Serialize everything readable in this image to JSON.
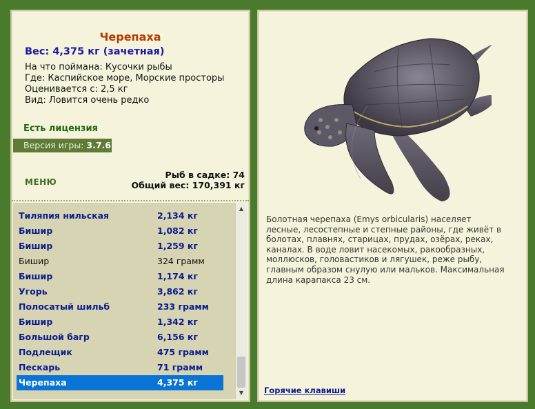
{
  "fish": {
    "title": "Черепаха",
    "weight_line": "Вес: 4,375 кг (зачетная)",
    "caught_on": "На что поймана: Кусочки рыбы",
    "location": "Где: Каспийское море, Морские просторы",
    "value": "Оценивается с: 2,5 кг",
    "rarity": "Вид: Ловится очень редко"
  },
  "license": "Есть лицензия",
  "version": {
    "label": "Версия игры:",
    "number": "3.7.6"
  },
  "menu_label": "МЕНЮ",
  "stats": {
    "fish_count": "Рыб в садке: 74",
    "total_weight": "Общий вес: 170,391 кг"
  },
  "catch_list": [
    {
      "name": "Тиляпия нильская",
      "weight": "2,134 кг",
      "style": "bold"
    },
    {
      "name": "Бишир",
      "weight": "1,082 кг",
      "style": "bold"
    },
    {
      "name": "Бишир",
      "weight": "1,259 кг",
      "style": "bold"
    },
    {
      "name": "Бишир",
      "weight": "324 грамм",
      "style": "plain"
    },
    {
      "name": "Бишир",
      "weight": "1,174 кг",
      "style": "bold"
    },
    {
      "name": "Угорь",
      "weight": "3,862 кг",
      "style": "bold"
    },
    {
      "name": "Полосатый шильб",
      "weight": "233 грамм",
      "style": "bold"
    },
    {
      "name": "Бишир",
      "weight": "1,342 кг",
      "style": "bold"
    },
    {
      "name": "Большой багр",
      "weight": "6,156 кг",
      "style": "bold"
    },
    {
      "name": "Подлещик",
      "weight": "475 грамм",
      "style": "bold"
    },
    {
      "name": "Пескарь",
      "weight": "71 грамм",
      "style": "bold"
    },
    {
      "name": "Черепаха",
      "weight": "4,375 кг",
      "style": "selected"
    }
  ],
  "description": "Болотная черепаха (Emys orbicularis) населяет лесные, лесостепные и степные районы, где живёт в болотах, плавнях, старицах, прудах, озёрах, реках, каналах. В воде ловит насекомых, ракообразных, моллюсков, головастиков и лягушек, реже рыбу, главным образом снулую или мальков. Максимальная длина карапакса 23 см.",
  "hotkeys_label": "Горячие клавиши",
  "icons": {
    "scroll_up": "triangle-up",
    "scroll_down": "triangle-down"
  }
}
